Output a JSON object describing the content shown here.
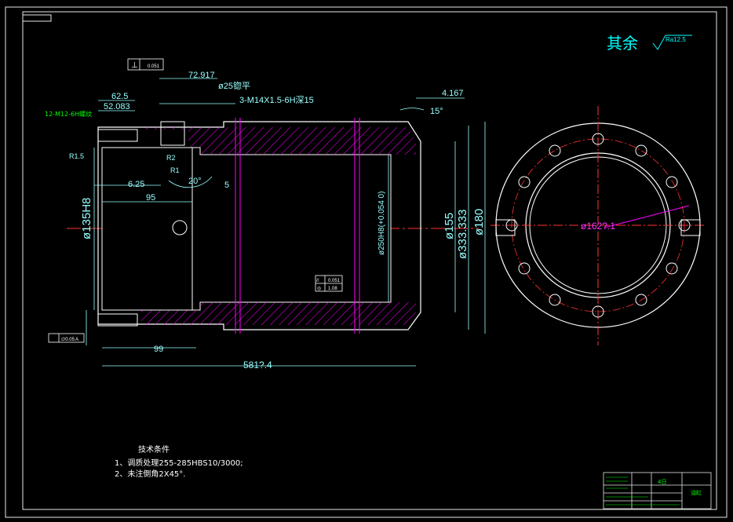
{
  "title_block": {
    "surface_label": "其余",
    "surface_symbol_text": "Ra12.5",
    "tb_text_a": "4日",
    "tb_text_b": "油缸"
  },
  "dimensions": {
    "d1": "72.917",
    "d2": "62.5",
    "d3": "52.083",
    "d4": "ø25锪平",
    "d5": "3-M14X1.5-6H深15",
    "d6": "4.167",
    "d7": "15°",
    "d8": "12-M12-6H螺纹",
    "d9": "R1.5",
    "d10": "R2",
    "d11": "R1",
    "d12": "20°",
    "d13": "5",
    "d14": "6.25",
    "d15": "95",
    "d16": "ø135H8",
    "d17": "ø250H8(+0.054 0)",
    "d18": "ø155",
    "d19": "ø333.333",
    "d20": "ø180",
    "d21": "ø162?.1",
    "d22": "99",
    "d23": "581?.4"
  },
  "gdt": {
    "perp_symbol": "⊥",
    "perp_value": "0.051",
    "g1": "//",
    "g1_value": "0.051",
    "g2": "◎",
    "g2_value": "1.08",
    "g3_value": "∅0.05",
    "datum": "A"
  },
  "notes": {
    "heading": "技术条件",
    "line1": "1、调质处理255-285HBS10/3000;",
    "line2": "2、未注倒角2X45°."
  }
}
